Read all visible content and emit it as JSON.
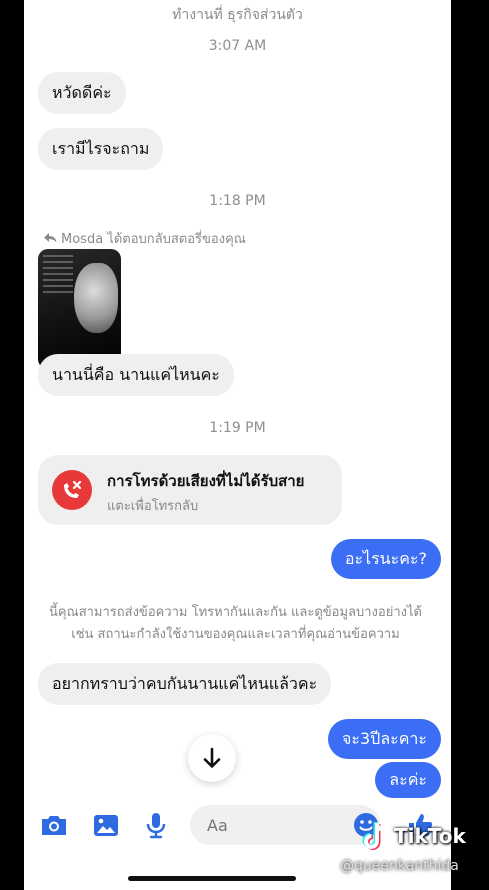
{
  "header": {
    "subtitle": "ทำงานที่ ธุรกิจส่วนตัว"
  },
  "messages": {
    "ts1": "3:07 AM",
    "m1": "หวัดดีค่ะ",
    "m2": "เรามีไรจะถาม",
    "ts2": "1:18 PM",
    "reply_note": "Mosda ได้ตอบกลับสตอรี่ของคุณ",
    "m3": "นานนี่คือ นานแค่ไหนคะ",
    "ts3": "1:19 PM",
    "call_title": "การโทรด้วยเสียงที่ไม่ได้รับสาย",
    "call_sub": "แตะเพื่อโทรกลับ",
    "out1": "อะไรนะคะ?",
    "notice_line1": "นี้คุณสามารถส่งข้อความ โทรหากันและกัน และดูข้อมูลบางอย่างได้",
    "notice_line2": "เช่น สถานะกำลังใช้งานของคุณและเวลาที่คุณอ่านข้อความ",
    "m4": "อยากทราบว่าคบกันนานแค่ไหนแล้วคะ",
    "out2": "จะ3ปีละคาะ",
    "out3": "ละค่ะ"
  },
  "composer": {
    "placeholder": "Aa"
  },
  "watermark": {
    "brand": "TikTok",
    "user": "@queenkanthida"
  },
  "colors": {
    "outgoing": "#3b6df5",
    "incoming": "#efefef",
    "missed_call": "#e8393a",
    "icons": "#2f6be0"
  },
  "icons": [
    "reply-arrow-icon",
    "missed-call-icon",
    "scroll-down-icon",
    "camera-icon",
    "gallery-icon",
    "microphone-icon",
    "sticker-icon",
    "thumbs-up-icon"
  ]
}
